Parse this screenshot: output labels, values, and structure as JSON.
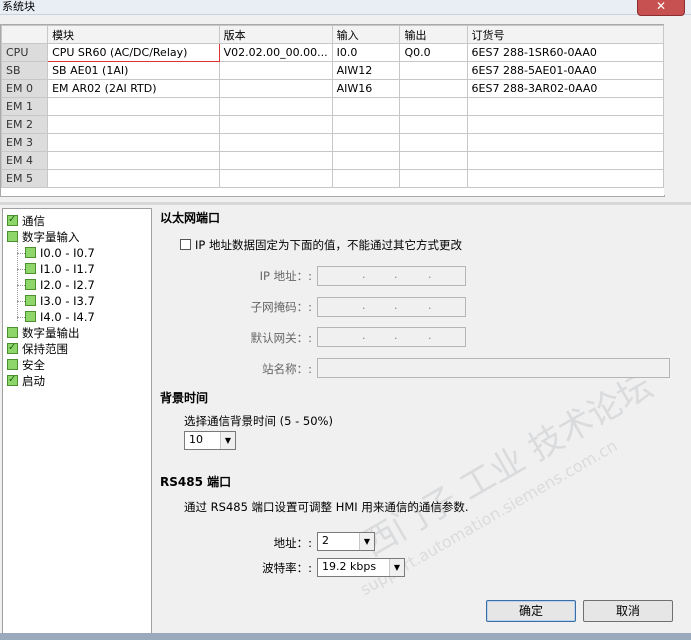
{
  "window": {
    "title": "系统块",
    "close_glyph": "✕"
  },
  "grid": {
    "columns": [
      "",
      "模块",
      "版本",
      "输入",
      "输出",
      "订货号"
    ],
    "rows": [
      {
        "slot": "CPU",
        "module": "CPU SR60 (AC/DC/Relay)",
        "version": "V02.02.00_00.00...",
        "input": "I0.0",
        "output": "Q0.0",
        "order": "6ES7 288-1SR60-0AA0"
      },
      {
        "slot": "SB",
        "module": "SB AE01 (1AI)",
        "version": "",
        "input": "AIW12",
        "output": "",
        "order": "6ES7 288-5AE01-0AA0"
      },
      {
        "slot": "EM 0",
        "module": "EM AR02 (2AI RTD)",
        "version": "",
        "input": "AIW16",
        "output": "",
        "order": "6ES7 288-3AR02-0AA0"
      },
      {
        "slot": "EM 1",
        "module": "",
        "version": "",
        "input": "",
        "output": "",
        "order": ""
      },
      {
        "slot": "EM 2",
        "module": "",
        "version": "",
        "input": "",
        "output": "",
        "order": ""
      },
      {
        "slot": "EM 3",
        "module": "",
        "version": "",
        "input": "",
        "output": "",
        "order": ""
      },
      {
        "slot": "EM 4",
        "module": "",
        "version": "",
        "input": "",
        "output": "",
        "order": ""
      },
      {
        "slot": "EM 5",
        "module": "",
        "version": "",
        "input": "",
        "output": "",
        "order": ""
      }
    ]
  },
  "tree": {
    "items": [
      {
        "label": "通信",
        "checked": true
      },
      {
        "label": "数字量输入",
        "checked": false
      },
      {
        "label": "I0.0 - I0.7",
        "checked": false
      },
      {
        "label": "I1.0 - I1.7",
        "checked": false
      },
      {
        "label": "I2.0 - I2.7",
        "checked": false
      },
      {
        "label": "I3.0 - I3.7",
        "checked": false
      },
      {
        "label": "I4.0 - I4.7",
        "checked": false
      },
      {
        "label": "数字量输出",
        "checked": false
      },
      {
        "label": "保持范围",
        "checked": true
      },
      {
        "label": "安全",
        "checked": false
      },
      {
        "label": "启动",
        "checked": true
      }
    ]
  },
  "ethernet": {
    "heading": "以太网端口",
    "fixed_ip_checkbox": "IP 地址数据固定为下面的值，不能通过其它方式更改",
    "ip_label": "IP 地址：:",
    "subnet_label": "子网掩码：:",
    "gateway_label": "默认网关：:",
    "station_label": "站名称：:",
    "dot": "."
  },
  "background": {
    "heading": "背景时间",
    "desc": "选择通信背景时间 (5 - 50%)",
    "value": "10"
  },
  "rs485": {
    "heading": "RS485 端口",
    "desc": "通过 RS485 端口设置可调整 HMI 用来通信的通信参数.",
    "address_label": "地址：:",
    "address_value": "2",
    "baud_label": "波特率：:",
    "baud_value": "19.2 kbps"
  },
  "buttons": {
    "ok": "确定",
    "cancel": "取消"
  },
  "watermark": {
    "line1": "西门子 工业 技术论坛",
    "line2": "support.automation.siemens.com.cn"
  },
  "colors": {
    "checkbox_green": "#8fd66a",
    "selection_border": "#d33333"
  }
}
